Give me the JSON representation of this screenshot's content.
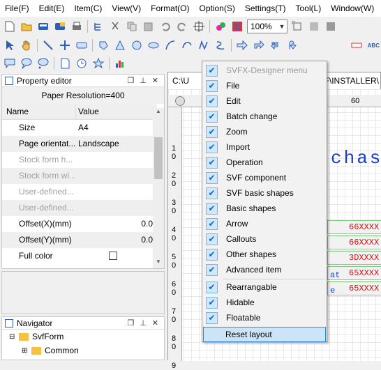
{
  "menubar": [
    "File(F)",
    "Edit(E)",
    "Item(C)",
    "View(V)",
    "Format(O)",
    "Option(S)",
    "Settings(T)",
    "Tool(L)",
    "Window(W)"
  ],
  "toolbar": {
    "zoom_value": "100%",
    "text_tool": "ABC"
  },
  "property_editor": {
    "title": "Property editor",
    "resolution": "Paper Resolution=400",
    "col_name": "Name",
    "col_value": "Value",
    "rows": [
      {
        "name": "Size",
        "value": "A4"
      },
      {
        "name": "Page orientat...",
        "value": "Landscape"
      },
      {
        "name": "Stock form h...",
        "value": ""
      },
      {
        "name": "Stock form wi...",
        "value": ""
      },
      {
        "name": "User-defined...",
        "value": ""
      },
      {
        "name": "User-defined...",
        "value": ""
      },
      {
        "name": "Offset(X)(mm)",
        "value": "0.0"
      },
      {
        "name": "Offset(Y)(mm)",
        "value": "0.0"
      },
      {
        "name": "Full color",
        "value": ""
      }
    ]
  },
  "navigator": {
    "title": "Navigator",
    "root": "SvfForm",
    "child": "Common"
  },
  "document": {
    "path_start": "C:\\U",
    "path_end": "VF\\INSTALLER\\",
    "hruler": [
      "60"
    ],
    "vruler": [
      "1",
      "0",
      "2",
      "0",
      "3",
      "0",
      "4",
      "0",
      "5",
      "0",
      "6",
      "0",
      "7",
      "0",
      "8",
      "0",
      "9"
    ],
    "title_text": "chas",
    "cells": [
      "66XXXX",
      "66XXXX",
      "3DXXXX",
      "65XXXX",
      "65XXXX"
    ],
    "left_frags": [
      "at",
      "e"
    ]
  },
  "popup_menu": {
    "items": [
      {
        "label": "SVFX-Designer menu",
        "disabled": true
      },
      {
        "label": "File"
      },
      {
        "label": "Edit"
      },
      {
        "label": "Batch change"
      },
      {
        "label": "Zoom"
      },
      {
        "label": "Import"
      },
      {
        "label": "Operation"
      },
      {
        "label": "SVF component"
      },
      {
        "label": "SVF basic shapes"
      },
      {
        "label": "Basic shapes"
      },
      {
        "label": "Arrow"
      },
      {
        "label": "Callouts"
      },
      {
        "label": "Other shapes"
      },
      {
        "label": "Advanced item"
      },
      {
        "label": "Rearrangable"
      },
      {
        "label": "Hidable"
      },
      {
        "label": "Floatable"
      }
    ],
    "reset_label": "Reset layout"
  },
  "colors": {
    "accent": "#2d88d8",
    "check_bg": "#cde8ff",
    "canvas_text": "#1a3fd0",
    "cell_text": "#d01010"
  }
}
